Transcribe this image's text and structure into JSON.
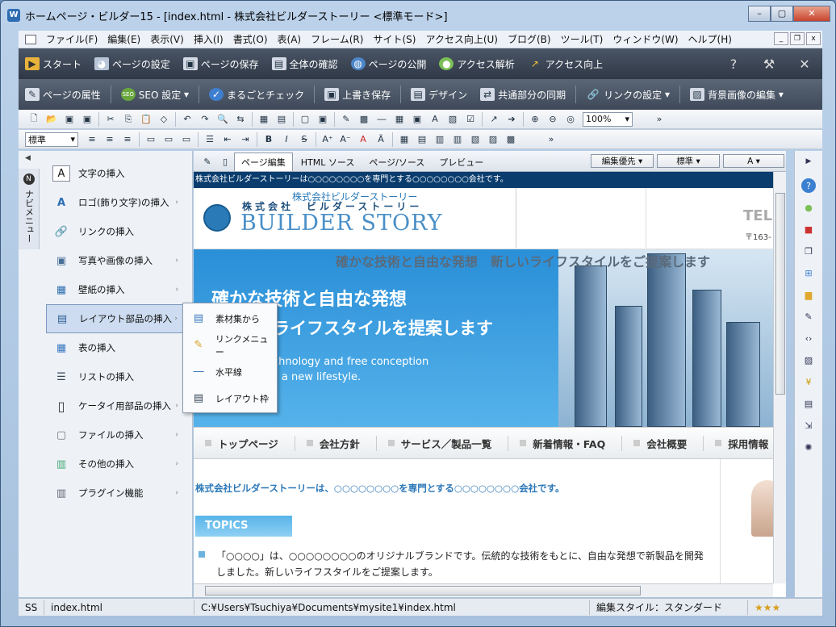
{
  "window": {
    "app_icon": "W",
    "title": "ホームページ・ビルダー15 - [index.html - 株式会社ビルダーストーリー <標準モード>]",
    "min": "–",
    "max": "▢",
    "close": "✕"
  },
  "menu": [
    "ファイル(F)",
    "編集(E)",
    "表示(V)",
    "挿入(I)",
    "書式(O)",
    "表(A)",
    "フレーム(R)",
    "サイト(S)",
    "アクセス向上(U)",
    "ブログ(B)",
    "ツール(T)",
    "ウィンドウ(W)",
    "ヘルプ(H)"
  ],
  "darkbar1": {
    "items": [
      "スタート",
      "ページの設定",
      "ページの保存",
      "全体の確認",
      "ページの公開",
      "アクセス解析",
      "アクセス向上"
    ],
    "right": [
      "?",
      "⚒",
      "✕"
    ]
  },
  "darkbar2": {
    "items": [
      "ページの属性",
      "SEO 設定",
      "まるごとチェック",
      "上書き保存",
      "デザイン",
      "共通部分の同期",
      "リンクの設定",
      "背景画像の編集"
    ]
  },
  "toolbar": {
    "zoom": "100%",
    "style": "標準"
  },
  "navpanel": {
    "tab_label": "ナビメニュー",
    "tab_badge": "N",
    "items": [
      {
        "label": "文字の挿入",
        "icon": "A",
        "sub": false
      },
      {
        "label": "ロゴ(飾り文字)の挿入",
        "icon": "A",
        "sub": true
      },
      {
        "label": "リンクの挿入",
        "icon": "🔗",
        "sub": false
      },
      {
        "label": "写真や画像の挿入",
        "icon": "▣",
        "sub": true
      },
      {
        "label": "壁紙の挿入",
        "icon": "▦",
        "sub": true
      },
      {
        "label": "レイアウト部品の挿入",
        "icon": "▤",
        "sub": true
      },
      {
        "label": "表の挿入",
        "icon": "▦",
        "sub": false
      },
      {
        "label": "リストの挿入",
        "icon": "☰",
        "sub": false
      },
      {
        "label": "ケータイ用部品の挿入",
        "icon": "▯",
        "sub": true
      },
      {
        "label": "ファイルの挿入",
        "icon": "▢",
        "sub": true
      },
      {
        "label": "その他の挿入",
        "icon": "▥",
        "sub": true
      },
      {
        "label": "プラグイン機能",
        "icon": "▥",
        "sub": true
      }
    ],
    "chevron": "›"
  },
  "submenu": [
    "素材集から",
    "リンクメニュー",
    "水平線",
    "レイアウト枠"
  ],
  "editor": {
    "tabs": [
      "ページ編集",
      "HTML ソース",
      "ページ/ソース",
      "プレビュー"
    ],
    "combo1": "編集優先",
    "combo2": "標準",
    "combo3": "A"
  },
  "page": {
    "topstrip": "株式会社ビルダーストーリーは○○○○○○○○を専門とする○○○○○○○○会社です。",
    "logo_small": "株式会社ビルダーストーリー",
    "logo_jp": "株式会社　ビルダーストーリー",
    "logo_en": "BUILDER STORY",
    "tel": "TEL",
    "zip": "〒163-",
    "hero_grey": "確かな技術と自由な発想　新しいライフスタイルをご提案します",
    "hero_h1": "確かな技術と自由な発想",
    "hero_h2": "ライフスタイルを提案します",
    "hero_e1": "chnology and free conception",
    "hero_e2": "s a new lifestyle.",
    "nav": [
      "トップページ",
      "会社方針",
      "サービス／製品一覧",
      "新着情報・FAQ",
      "会社概要",
      "採用情報"
    ],
    "lead": "株式会社ビルダーストーリーは、○○○○○○○○を専門とする○○○○○○○○会社です。",
    "topics": "TOPICS",
    "news": "「○○○○」は、○○○○○○○○のオリジナルブランドです。伝統的な技術をもとに、自由な発想で新製品を開発しました。新しいライフスタイルをご提案します。"
  },
  "statusbar": {
    "mode": "SS",
    "file": "index.html",
    "path": "C:¥Users¥Tsuchiya¥Documents¥mysite1¥index.html",
    "style": "編集スタイル：スタンダード",
    "stars": "★★★"
  }
}
